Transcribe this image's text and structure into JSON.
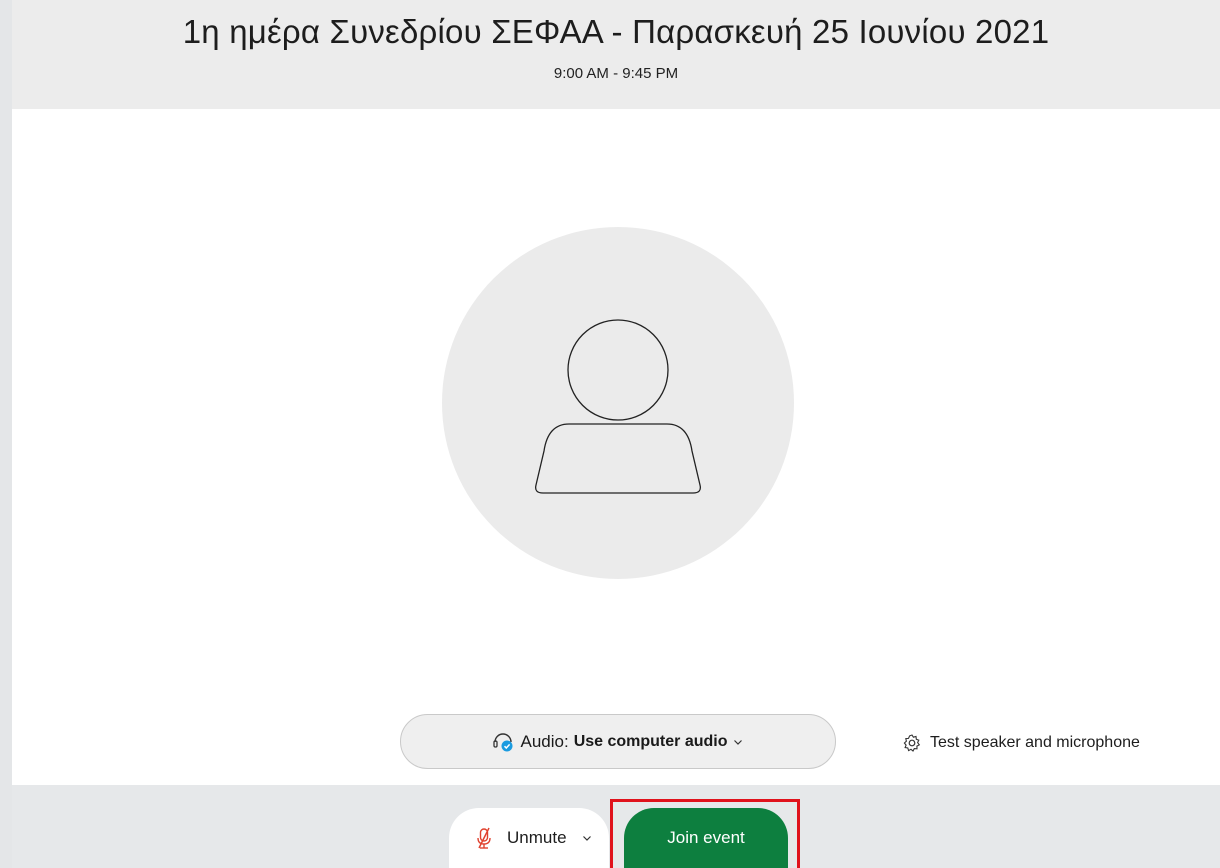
{
  "event": {
    "title": "1η ημέρα Συνεδρίου ΣΕΦΑΑ - Παρασκευή 25 Ιουνίου 2021",
    "time": "9:00 AM - 9:45 PM"
  },
  "audio": {
    "prefix": "Audio:",
    "value": "Use computer audio",
    "icon": "headset-icon"
  },
  "test_link": {
    "label": "Test speaker and microphone",
    "icon": "gear-icon"
  },
  "unmute": {
    "label": "Unmute",
    "icon": "muted-mic-icon"
  },
  "join": {
    "label": "Join event"
  },
  "colors": {
    "join_button": "#0d7f3f",
    "highlight_frame": "#e0121c",
    "muted_mic": "#e0422f",
    "status_check": "#1a9be0"
  }
}
